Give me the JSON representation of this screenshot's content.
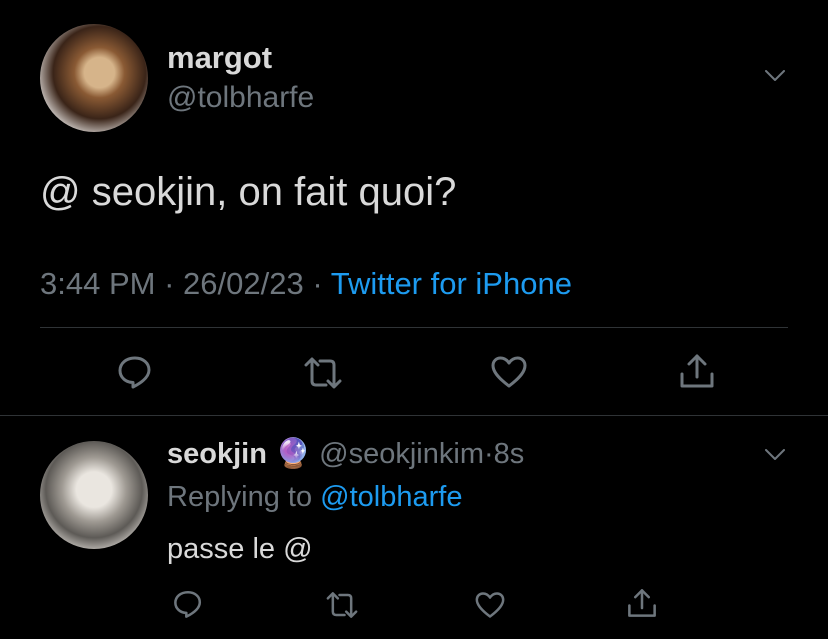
{
  "tweet": {
    "display_name": "margot",
    "handle": "@tolbharfe",
    "text": "@ seokjin, on fait quoi?",
    "time": "3:44 PM",
    "date": "26/02/23",
    "separator": "·",
    "source": "Twitter for iPhone",
    "actions": [
      "reply-icon",
      "retweet-icon",
      "like-icon",
      "share-icon"
    ]
  },
  "reply": {
    "display_name": "seokjin",
    "emoji": "🔮",
    "handle": "@seokjinkim",
    "separator": "·",
    "age": "8s",
    "replying_label": "Replying to",
    "replying_to": "@tolbharfe",
    "text": "passe le @",
    "actions": [
      "reply-icon",
      "retweet-icon",
      "like-icon",
      "share-icon"
    ]
  },
  "colors": {
    "background": "#000000",
    "text": "#d9d9d9",
    "muted": "#6e767d",
    "link": "#1d9bf0",
    "divider": "#2f3336"
  }
}
